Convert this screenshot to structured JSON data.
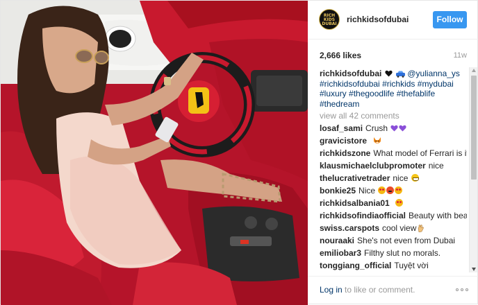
{
  "post": {
    "username": "richkidsofdubai",
    "avatar_text": "RICH KIDS DUBAI",
    "follow_label": "Follow",
    "likes": "2,666 likes",
    "age": "11w",
    "caption": {
      "user": "richkidsofdubai",
      "mention": "@yulianna_ys",
      "hashtags": [
        "#richkidsofdubai",
        "#richkids",
        "#mydubai",
        "#luxury",
        "#thegoodlife",
        "#thefablife",
        "#thedream"
      ]
    },
    "view_all": "view all 42 comments",
    "comments": [
      {
        "user": "losaf_sami",
        "text": "Crush",
        "emoji": "purple-hearts"
      },
      {
        "user": "gravicistore",
        "text": "",
        "emoji": "fox"
      },
      {
        "user": "richkidszone",
        "text": "What model of Ferrari is it?",
        "emoji": ""
      },
      {
        "user": "klausmichaelclubpromoter",
        "text": "nice",
        "emoji": ""
      },
      {
        "user": "thelucrativetrader",
        "text": "nice",
        "emoji": "grin"
      },
      {
        "user": "bonkie25",
        "text": "Nice",
        "emoji": "heart-eyes-angry-heart-eyes"
      },
      {
        "user": "richkidsalbania01",
        "text": "",
        "emoji": "heart-eyes"
      },
      {
        "user": "richkidsofindiaofficial",
        "text": "Beauty with beast",
        "emoji": ""
      },
      {
        "user": "swiss.carspots",
        "text": "cool view",
        "emoji": "hand"
      },
      {
        "user": "nouraaki",
        "text": "She's not even from Dubai",
        "emoji": ""
      },
      {
        "user": "emiliobar3",
        "text": "Filthy slut no morals.",
        "emoji": ""
      },
      {
        "user": "tonggiang_official",
        "text": "Tuyệt vời",
        "emoji": ""
      }
    ],
    "footer": {
      "login_link": "Log in",
      "login_rest": " to like or comment."
    }
  },
  "colors": {
    "accent": "#3897f0",
    "link": "#003569",
    "muted": "#999999",
    "car_red": "#c0182a"
  },
  "icons": [
    "more-options-icon",
    "purple-heart-icon",
    "car-icon",
    "fox-icon",
    "grin-icon",
    "heart-eyes-icon",
    "angry-icon",
    "hand-icon",
    "ferrari-logo-icon"
  ]
}
